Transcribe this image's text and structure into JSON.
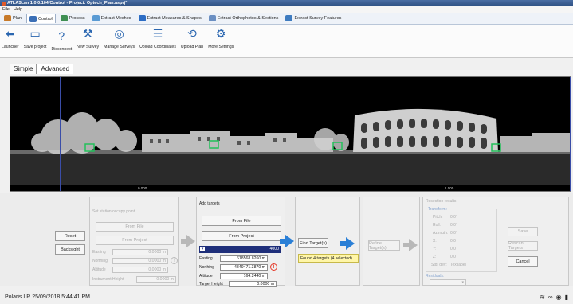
{
  "window": {
    "title": "ATLAScan 1.0.0.104/Control - Project: Optech_Plan.asprj*"
  },
  "menu": [
    "File",
    "Help"
  ],
  "ribbon_tabs": [
    {
      "label": "Plan",
      "active": false,
      "color": "#c77a2a"
    },
    {
      "label": "Control",
      "active": true,
      "color": "#3b6fb6"
    },
    {
      "label": "Process",
      "active": false,
      "color": "#3f8f52"
    },
    {
      "label": "Extract Meshes",
      "active": false,
      "color": "#5a9bd4"
    },
    {
      "label": "Extract Measures & Shapes",
      "active": false,
      "color": "#2b6cc4"
    },
    {
      "label": "Extract Orthophotos & Sections",
      "active": false,
      "color": "#6b8fc2"
    },
    {
      "label": "Extract Survey Features",
      "active": false,
      "color": "#3e7bbf"
    }
  ],
  "ribbon_buttons": [
    {
      "label": "Launcher",
      "icon": "back-arrow-icon",
      "glyph": "⬅"
    },
    {
      "label": "Save project",
      "icon": "save-icon",
      "glyph": "▭"
    },
    {
      "label": "Disconnect",
      "icon": "disconnect-icon",
      "glyph": "?"
    },
    {
      "label": "New Survey",
      "icon": "survey-icon",
      "glyph": "⚒"
    },
    {
      "label": "Manage Surveys",
      "icon": "manage-surveys-icon",
      "glyph": "◎"
    },
    {
      "label": "Upload Coordinates",
      "icon": "upload-coordinates-icon",
      "glyph": "☰"
    },
    {
      "label": "Upload Plan",
      "icon": "upload-plan-icon",
      "glyph": "⟲"
    },
    {
      "label": "More Settings",
      "icon": "settings-gear-icon",
      "glyph": "⚙"
    }
  ],
  "mode_tabs": [
    {
      "label": "Simple",
      "active": false
    },
    {
      "label": "Advanced",
      "active": true
    }
  ],
  "viewport": {
    "tick_left": "0.000",
    "tick_right": "1.000",
    "markers": 4
  },
  "controls": {
    "reset_label": "Reset",
    "backsight_label": "Backsight",
    "station": {
      "title": "Set station occupy point",
      "from_file": "From File",
      "from_project": "From Project",
      "easting_label": "Easting",
      "easting_value": "0.0000 m",
      "northing_label": "Northing",
      "northing_value": "0.0000 m",
      "altitude_label": "Altitude",
      "altitude_value": "0.0000 m",
      "instrument_height_label": "Instrument Height",
      "instrument_height_value": "0.0000 m"
    },
    "targets": {
      "title": "Add targets",
      "from_file": "From File",
      "from_project": "From Project",
      "target_id": "4000",
      "easting_label": "Easting",
      "easting_value": "618568.8260 m",
      "northing_label": "Northing",
      "northing_value": "4849471.3870 m",
      "altitude_label": "Altitude",
      "altitude_value": "164.2440 m",
      "target_height_label": "Target Height",
      "target_height_value": "0.0000 m"
    },
    "find_targets_label": "Find Target(s)",
    "found_message": "Found 4 targets (4 selected)",
    "refine_targets_label": "Refine Target(s)",
    "resection": {
      "title": "Resection results",
      "transform_label": "Transform:",
      "pitch_label": "Pitch:",
      "pitch_value": "0.0°",
      "roll_label": "Roll:",
      "roll_value": "0.0°",
      "azimuth_label": "Azimuth:",
      "azimuth_value": "0.0°",
      "x_label": "X:",
      "x_value": "0.0",
      "y_label": "Y:",
      "y_value": "0.0",
      "z_label": "Z:",
      "z_value": "0.0",
      "std_label": "Std. dev:",
      "std_value": "Textlabel",
      "residuals_label": "Residuals:"
    },
    "save_label": "Save",
    "rescan_label": "Rescan Targets",
    "cancel_label": "Cancel"
  },
  "status": {
    "text": "Polaris LR 25/09/2018 5:44:41 PM"
  },
  "colors": {
    "accent_blue": "#2a7fd6",
    "target_marker": "#22c05a",
    "warning": "#e53a2a",
    "highlight": "#fff6a8",
    "selected_row": "#1f2f7a"
  }
}
